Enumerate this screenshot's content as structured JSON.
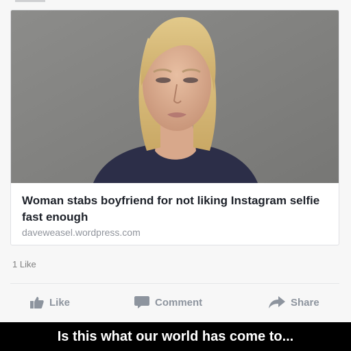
{
  "post": {
    "link_preview": {
      "image_alt": "mugshot-photo",
      "headline": "Woman stabs boyfriend for not liking Instagram selfie fast enough",
      "domain": "daveweasel.wordpress.com"
    },
    "like_count": "1 Like",
    "actions": {
      "like_label": "Like",
      "comment_label": "Comment",
      "share_label": "Share"
    }
  },
  "caption": {
    "text": "Is this what our world has come to..."
  },
  "colors": {
    "action_gray": "#8d949e",
    "headline": "#1d2129",
    "caption_background": "#000000"
  }
}
